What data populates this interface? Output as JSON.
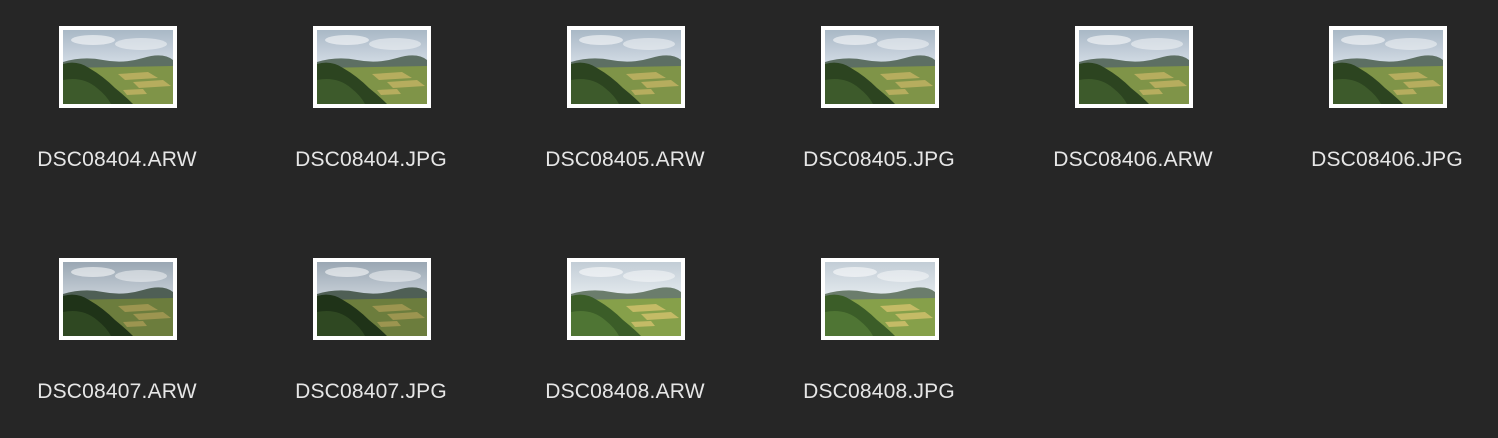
{
  "files": [
    {
      "name": "DSC08404.ARW",
      "thumbnail": "mountain-valley-landscape",
      "variant": "a"
    },
    {
      "name": "DSC08404.JPG",
      "thumbnail": "mountain-valley-landscape",
      "variant": "a"
    },
    {
      "name": "DSC08405.ARW",
      "thumbnail": "mountain-valley-landscape",
      "variant": "a"
    },
    {
      "name": "DSC08405.JPG",
      "thumbnail": "mountain-valley-landscape",
      "variant": "a"
    },
    {
      "name": "DSC08406.ARW",
      "thumbnail": "mountain-valley-landscape",
      "variant": "a"
    },
    {
      "name": "DSC08406.JPG",
      "thumbnail": "mountain-valley-landscape",
      "variant": "a"
    },
    {
      "name": "DSC08407.ARW",
      "thumbnail": "mountain-valley-landscape",
      "variant": "b"
    },
    {
      "name": "DSC08407.JPG",
      "thumbnail": "mountain-valley-landscape",
      "variant": "b"
    },
    {
      "name": "DSC08408.ARW",
      "thumbnail": "mountain-valley-landscape",
      "variant": "c"
    },
    {
      "name": "DSC08408.JPG",
      "thumbnail": "mountain-valley-landscape",
      "variant": "c"
    }
  ],
  "colors": {
    "background": "#262626",
    "label": "#e6e6e6",
    "thumbnail_border": "#ffffff"
  }
}
